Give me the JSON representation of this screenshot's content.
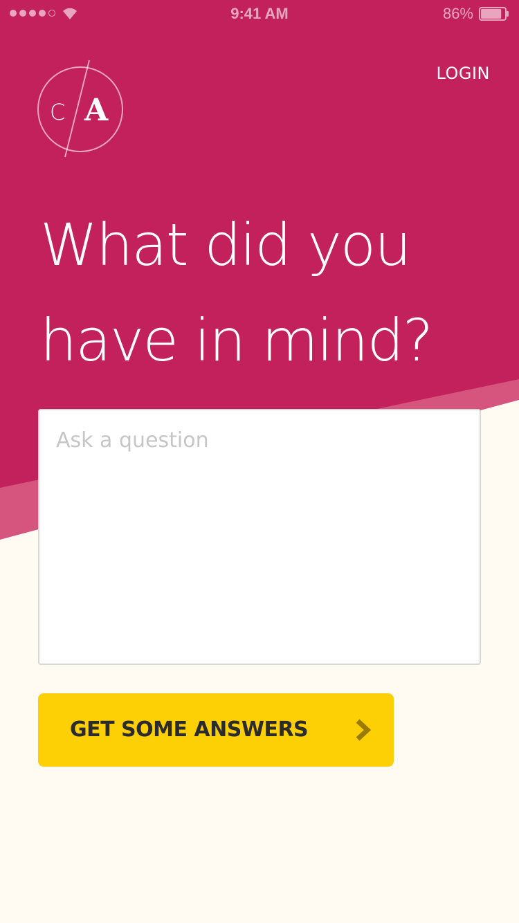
{
  "status_bar": {
    "time": "9:41 AM",
    "battery_percent": "86%",
    "battery_level": 0.86,
    "signal_bars_filled": 4,
    "signal_bars_total": 5
  },
  "header": {
    "login_label": "LOGIN",
    "logo_left": "C",
    "logo_right": "A"
  },
  "main": {
    "headline_line1": "What did you",
    "headline_line2": "have in mind?",
    "question_placeholder": "Ask a question",
    "question_value": "",
    "submit_label": "GET SOME ANSWERS",
    "submit_icon": "chevron-right-icon"
  },
  "colors": {
    "brand_magenta": "#C3215B",
    "accent_pink": "#D6557F",
    "background_cream": "#FFFBF3",
    "button_yellow": "#FDD005",
    "button_text": "#2B2B2B",
    "chevron": "#9A7A03"
  }
}
